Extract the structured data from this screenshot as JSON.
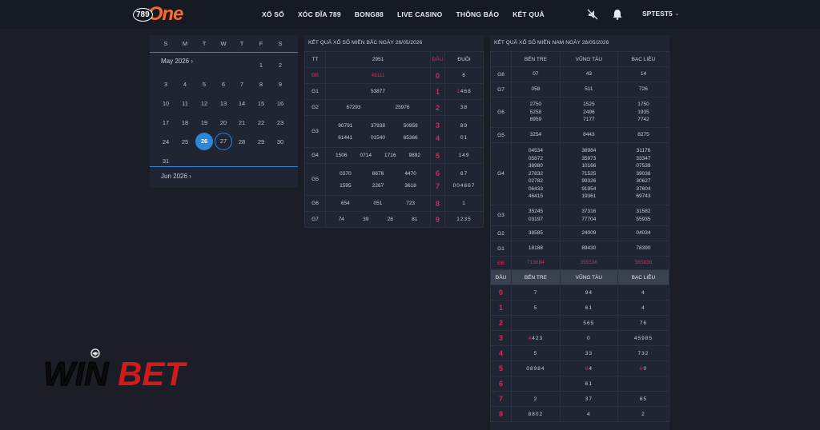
{
  "logo": {
    "num": "789",
    "word": "One"
  },
  "nav": {
    "menu": [
      "XỔ SỐ",
      "XÓC ĐĨA 789",
      "BONG88",
      "LIVE CASINO",
      "THÔNG BÁO",
      "KẾT QUẢ"
    ],
    "username": "SPTEST5"
  },
  "calendar": {
    "dow": [
      "S",
      "M",
      "T",
      "W",
      "T",
      "F",
      "S"
    ],
    "month": "May 2026",
    "next_month": "Jun 2026",
    "rows": [
      [
        "",
        "",
        "",
        "",
        "",
        "1",
        "2"
      ],
      [
        "3",
        "4",
        "5",
        "6",
        "7",
        "8",
        "9"
      ],
      [
        "10",
        "11",
        "12",
        "13",
        "14",
        "15",
        "16"
      ],
      [
        "17",
        "18",
        "19",
        "20",
        "21",
        "22",
        "23"
      ],
      [
        "24",
        "25",
        "26",
        "27",
        "28",
        "29",
        "30"
      ],
      [
        "31",
        "",
        "",
        "",
        "",
        "",
        ""
      ]
    ],
    "selected": "26",
    "today": "27"
  },
  "mien_bac": {
    "title": "KẾT QUẢ XỔ SỐ MIỀN BẮC NGÀY 26/05/2026",
    "headers": [
      "TT",
      "2951",
      "ĐẦU",
      "ĐUÔI"
    ],
    "rows": [
      {
        "label": "ĐB",
        "values": [
          "49111"
        ],
        "dau": "0",
        "duoi": "6"
      },
      {
        "label": "G1",
        "values": [
          "53877"
        ],
        "dau": "1",
        "duoi": "1468"
      },
      {
        "label": "G2",
        "values": [
          "67293",
          "25976"
        ],
        "dau": "2",
        "duoi": "38"
      },
      {
        "label": "G3",
        "values": [
          "90791",
          "37938",
          "50959",
          "61441",
          "01540",
          "65366"
        ],
        "dau": "3",
        "duoi": "89",
        "dau2": "4",
        "duoi2": "01"
      },
      {
        "label": "G4",
        "values": [
          "1506",
          "0714",
          "1716",
          "9892"
        ],
        "dau": "5",
        "duoi": "149"
      },
      {
        "label": "G5",
        "values": [
          "0370",
          "6676",
          "4470",
          "1595",
          "2267",
          "3618"
        ],
        "dau": "6",
        "duoi": "67",
        "dau2": "7",
        "duoi2": "004667"
      },
      {
        "label": "G6",
        "values": [
          "654",
          "051",
          "723"
        ],
        "dau": "8",
        "duoi": "1"
      },
      {
        "label": "G7",
        "values": [
          "74",
          "39",
          "28",
          "81"
        ],
        "dau": "9",
        "duoi": "1235"
      }
    ]
  },
  "mien_nam": {
    "title": "KẾT QUẢ XỔ SỐ MIỀN NAM NGÀY 26/05/2026",
    "provinces": [
      "BẾN TRE",
      "VŨNG TÀU",
      "BẠC LIÊU"
    ],
    "rows": [
      {
        "label": "G8",
        "cols": [
          [
            "07"
          ],
          [
            "43"
          ],
          [
            "14"
          ]
        ]
      },
      {
        "label": "G7",
        "cols": [
          [
            "058"
          ],
          [
            "511"
          ],
          [
            "726"
          ]
        ]
      },
      {
        "label": "G6",
        "cols": [
          [
            "2750",
            "5258",
            "8959"
          ],
          [
            "1525",
            "2496",
            "7177"
          ],
          [
            "1750",
            "1935",
            "7742"
          ]
        ]
      },
      {
        "label": "G5",
        "cols": [
          [
            "3254"
          ],
          [
            "8443"
          ],
          [
            "8275"
          ]
        ]
      },
      {
        "label": "G4",
        "cols": [
          [
            "04534",
            "05872",
            "38980",
            "27832",
            "02782",
            "06433",
            "46415"
          ],
          [
            "38984",
            "35973",
            "10166",
            "71525",
            "99326",
            "91954",
            "19361"
          ],
          [
            "31176",
            "33347",
            "07539",
            "39038",
            "30627",
            "37604",
            "69743"
          ]
        ]
      },
      {
        "label": "G3",
        "cols": [
          [
            "35245",
            "03197"
          ],
          [
            "37316",
            "77704"
          ],
          [
            "31582",
            "55935"
          ]
        ]
      },
      {
        "label": "G2",
        "cols": [
          [
            "38585"
          ],
          [
            "24009"
          ],
          [
            "04034"
          ]
        ]
      },
      {
        "label": "G1",
        "cols": [
          [
            "18188"
          ],
          [
            "89430"
          ],
          [
            "78390"
          ]
        ]
      },
      {
        "label": "ĐB",
        "cols": [
          [
            "713684"
          ],
          [
            "355536"
          ],
          [
            "565836"
          ]
        ]
      }
    ],
    "dau_header": "ĐẦU",
    "dau_rows": [
      {
        "dau": "0",
        "cols": [
          "7",
          "94",
          "4"
        ]
      },
      {
        "dau": "1",
        "cols": [
          "5",
          "61",
          "4"
        ]
      },
      {
        "dau": "2",
        "cols": [
          "",
          "565",
          "76"
        ]
      },
      {
        "dau": "3",
        "cols": [
          "4423",
          "0",
          "45985"
        ]
      },
      {
        "dau": "4",
        "cols": [
          "5",
          "33",
          "732"
        ]
      },
      {
        "dau": "5",
        "cols": [
          "08984",
          "84",
          "60"
        ]
      },
      {
        "dau": "6",
        "cols": [
          "",
          "61",
          ""
        ]
      },
      {
        "dau": "7",
        "cols": [
          "2",
          "37",
          "65"
        ]
      },
      {
        "dau": "8",
        "cols": [
          "8802",
          "4",
          "2"
        ]
      }
    ]
  },
  "watermark": {
    "text": "WINBET"
  },
  "colors": {
    "accent": "#2f86d6",
    "red": "#e0245e",
    "logo": "#ff6a2a",
    "watermark_red": "#d11a1a"
  }
}
